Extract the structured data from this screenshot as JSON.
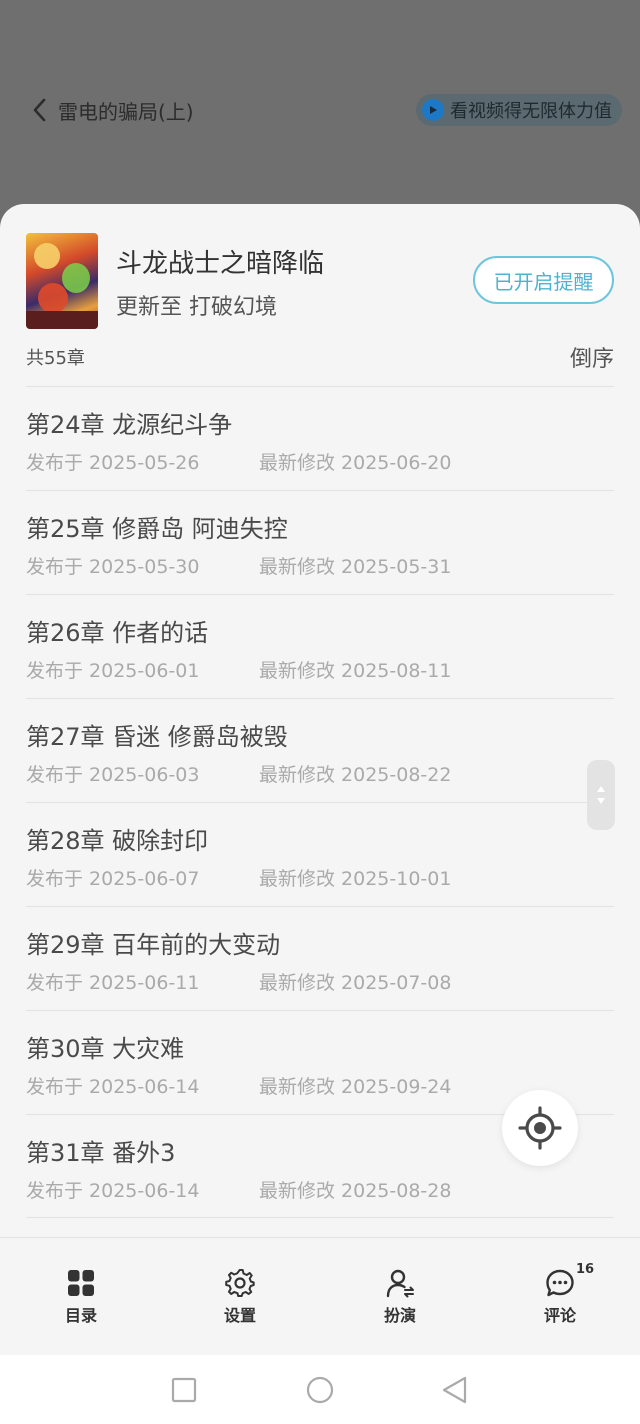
{
  "header": {
    "back_title": "雷电的骗局(上)",
    "video_promo": "看视频得无限体力值"
  },
  "book": {
    "title": "斗龙战士之暗降临",
    "update_text": "更新至 打破幻境",
    "remind_button": "已开启提醒",
    "chapter_count": "共55章",
    "order_button": "倒序"
  },
  "chapters": [
    {
      "title": "第24章 龙源纪斗争",
      "published": "发布于 2025-05-26",
      "modified": "最新修改 2025-06-20"
    },
    {
      "title": "第25章 修爵岛 阿迪失控",
      "published": "发布于 2025-05-30",
      "modified": "最新修改 2025-05-31"
    },
    {
      "title": "第26章 作者的话",
      "published": "发布于 2025-06-01",
      "modified": "最新修改 2025-08-11"
    },
    {
      "title": "第27章 昏迷 修爵岛被毁",
      "published": "发布于 2025-06-03",
      "modified": "最新修改 2025-08-22"
    },
    {
      "title": "第28章 破除封印",
      "published": "发布于 2025-06-07",
      "modified": "最新修改 2025-10-01"
    },
    {
      "title": "第29章 百年前的大变动",
      "published": "发布于 2025-06-11",
      "modified": "最新修改 2025-07-08"
    },
    {
      "title": "第30章 大灾难",
      "published": "发布于 2025-06-14",
      "modified": "最新修改 2025-09-24"
    },
    {
      "title": "第31章 番外3",
      "published": "发布于 2025-06-14",
      "modified": "最新修改 2025-08-28"
    }
  ],
  "tabs": {
    "catalog": "目录",
    "settings": "设置",
    "roleplay": "扮演",
    "comments": "评论",
    "comments_badge": "16"
  },
  "icons": {
    "back": "chevron-left-icon",
    "video": "play-icon",
    "locate": "crosshair-icon",
    "catalog": "grid-icon",
    "settings": "gear-icon",
    "roleplay": "person-icon",
    "comments": "chat-bubble-icon"
  },
  "colors": {
    "accent": "#4fb3cf",
    "sheet_bg": "#f5f5f5",
    "dim_bg": "#6f6f6f"
  }
}
